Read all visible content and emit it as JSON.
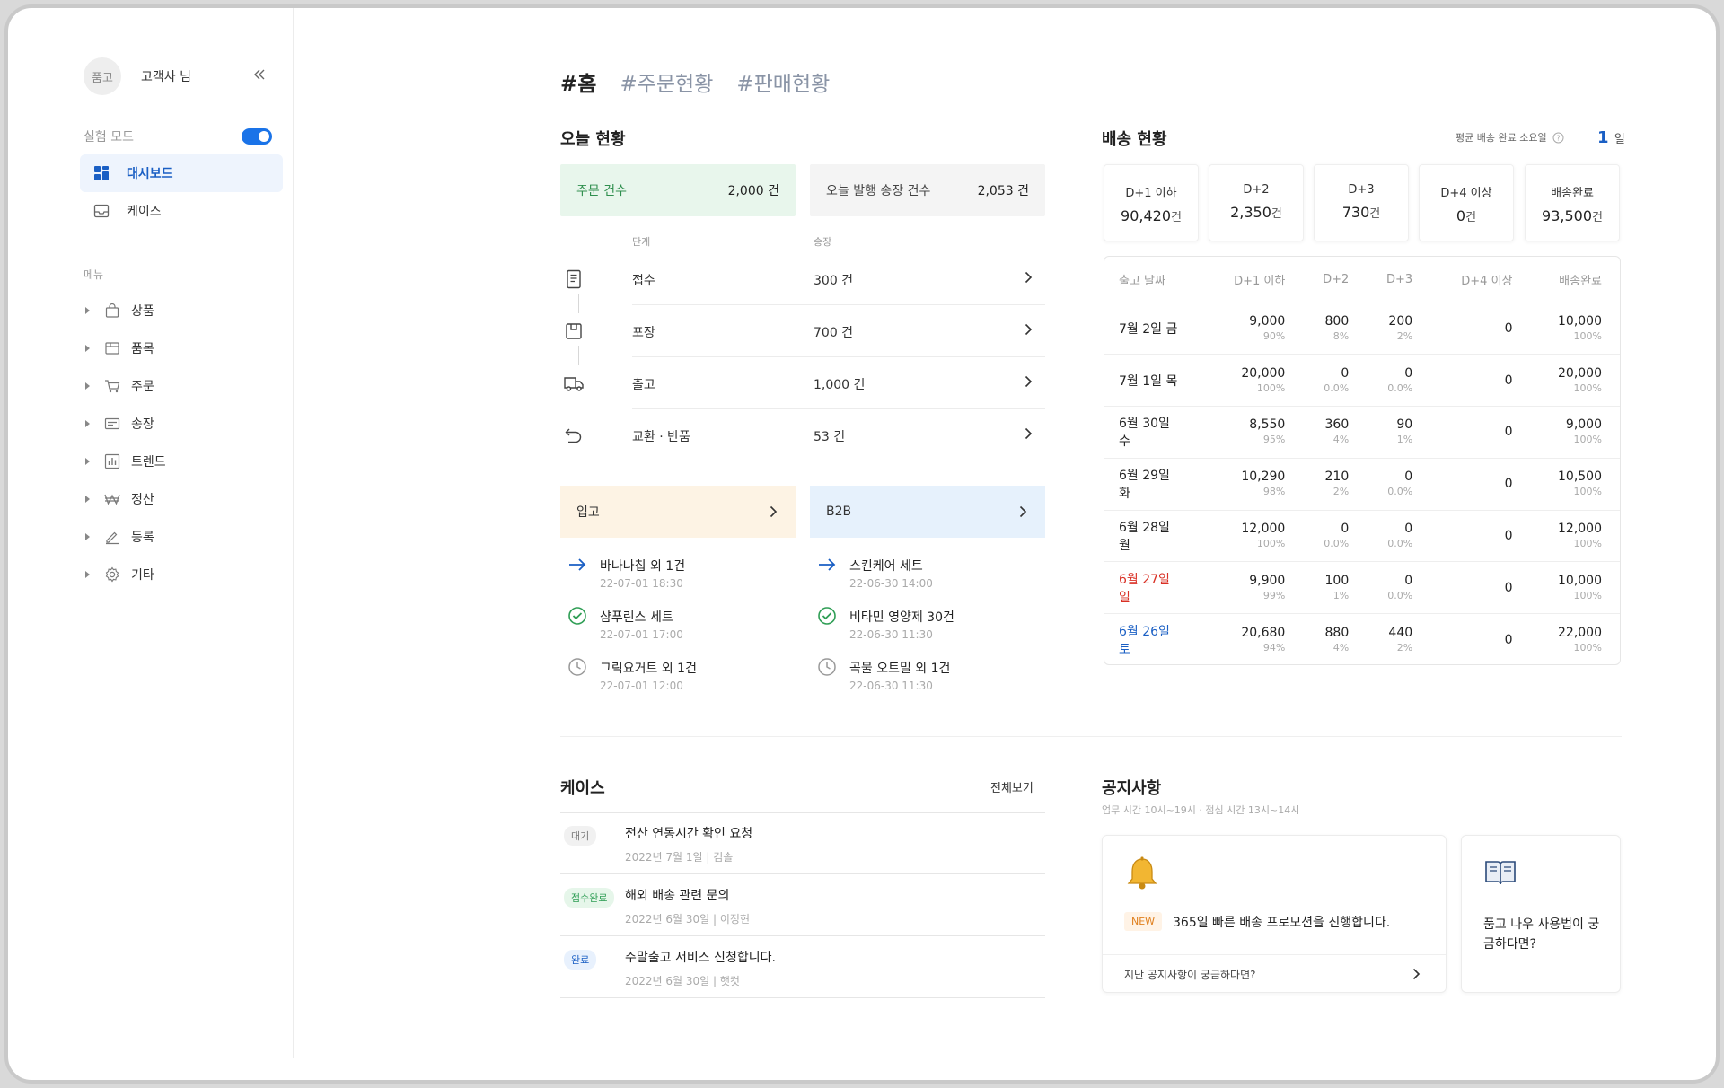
{
  "sidebar": {
    "avatar_text": "품고",
    "user_name": "고객사 님",
    "test_mode_label": "실험 모드",
    "nav": [
      {
        "label": "대시보드",
        "active": true,
        "icon": "dashboard-icon"
      },
      {
        "label": "케이스",
        "active": false,
        "icon": "inbox-icon"
      }
    ],
    "menu_label": "메뉴",
    "menu": [
      {
        "label": "상품",
        "icon": "bag-icon"
      },
      {
        "label": "품목",
        "icon": "box-icon"
      },
      {
        "label": "주문",
        "icon": "cart-icon"
      },
      {
        "label": "송장",
        "icon": "invoice-icon"
      },
      {
        "label": "트렌드",
        "icon": "chart-icon"
      },
      {
        "label": "정산",
        "icon": "won-icon"
      },
      {
        "label": "등록",
        "icon": "pencil-icon"
      },
      {
        "label": "기타",
        "icon": "gear-icon"
      }
    ]
  },
  "tabs": [
    "#홈",
    "#주문현황",
    "#판매현황"
  ],
  "today": {
    "title": "오늘 현황",
    "orders_label": "주문 건수",
    "orders_value": "2,000 건",
    "invoices_label": "오늘 발행 송장 건수",
    "invoices_value": "2,053 건",
    "col_stage": "단계",
    "col_invoice": "송장",
    "steps": [
      {
        "label": "접수",
        "count": "300 건",
        "icon": "receipt-icon"
      },
      {
        "label": "포장",
        "count": "700 건",
        "icon": "package-icon"
      },
      {
        "label": "출고",
        "count": "1,000 건",
        "icon": "truck-icon"
      },
      {
        "label": "교환 · 반품",
        "count": "53 건",
        "icon": "return-icon"
      }
    ],
    "inbound_label": "입고",
    "b2b_label": "B2B",
    "inbound_feed": [
      {
        "title": "바나나칩 외 1건",
        "time": "22-07-01 18:30",
        "icon": "arrow-right-icon"
      },
      {
        "title": "샴푸린스 세트",
        "time": "22-07-01 17:00",
        "icon": "check-circle-icon"
      },
      {
        "title": "그릭요거트 외 1건",
        "time": "22-07-01 12:00",
        "icon": "clock-icon"
      }
    ],
    "b2b_feed": [
      {
        "title": "스킨케어 세트",
        "time": "22-06-30 14:00",
        "icon": "arrow-right-icon"
      },
      {
        "title": "비타민 영양제 30건",
        "time": "22-06-30 11:30",
        "icon": "check-circle-icon"
      },
      {
        "title": "곡물 오트밀 외 1건",
        "time": "22-06-30 11:30",
        "icon": "clock-icon"
      }
    ]
  },
  "delivery": {
    "title": "배송 현황",
    "avg_label": "평균 배송 완료 소요일",
    "avg_value": "1",
    "avg_unit": "일",
    "cards": [
      {
        "label": "D+1 이하",
        "value": "90,420",
        "unit": "건"
      },
      {
        "label": "D+2",
        "value": "2,350",
        "unit": "건"
      },
      {
        "label": "D+3",
        "value": "730",
        "unit": "건"
      },
      {
        "label": "D+4 이상",
        "value": "0",
        "unit": "건"
      },
      {
        "label": "배송완료",
        "value": "93,500",
        "unit": "건"
      }
    ],
    "columns": [
      "출고 날짜",
      "D+1 이하",
      "D+2",
      "D+3",
      "D+4 이상",
      "배송완료"
    ],
    "rows": [
      {
        "date": "7월 2일 금",
        "day": "weekday",
        "d1": "9,000",
        "d1p": "90%",
        "d2": "800",
        "d2p": "8%",
        "d3": "200",
        "d3p": "2%",
        "d4": "0",
        "done": "10,000",
        "donep": "100%"
      },
      {
        "date": "7월 1일 목",
        "day": "weekday",
        "d1": "20,000",
        "d1p": "100%",
        "d2": "0",
        "d2p": "0.0%",
        "d3": "0",
        "d3p": "0.0%",
        "d4": "0",
        "done": "20,000",
        "donep": "100%"
      },
      {
        "date": "6월 30일 수",
        "day": "weekday",
        "d1": "8,550",
        "d1p": "95%",
        "d2": "360",
        "d2p": "4%",
        "d3": "90",
        "d3p": "1%",
        "d4": "0",
        "done": "9,000",
        "donep": "100%"
      },
      {
        "date": "6월 29일 화",
        "day": "weekday",
        "d1": "10,290",
        "d1p": "98%",
        "d2": "210",
        "d2p": "2%",
        "d3": "0",
        "d3p": "0.0%",
        "d4": "0",
        "done": "10,500",
        "donep": "100%"
      },
      {
        "date": "6월 28일 월",
        "day": "weekday",
        "d1": "12,000",
        "d1p": "100%",
        "d2": "0",
        "d2p": "0.0%",
        "d3": "0",
        "d3p": "0.0%",
        "d4": "0",
        "done": "12,000",
        "donep": "100%"
      },
      {
        "date": "6월 27일 일",
        "day": "sun",
        "d1": "9,900",
        "d1p": "99%",
        "d2": "100",
        "d2p": "1%",
        "d3": "0",
        "d3p": "0.0%",
        "d4": "0",
        "done": "10,000",
        "donep": "100%"
      },
      {
        "date": "6월 26일 토",
        "day": "sat",
        "d1": "20,680",
        "d1p": "94%",
        "d2": "880",
        "d2p": "4%",
        "d3": "440",
        "d3p": "2%",
        "d4": "0",
        "done": "22,000",
        "donep": "100%"
      }
    ]
  },
  "cases": {
    "title": "케이스",
    "see_all": "전체보기",
    "items": [
      {
        "badge": "대기",
        "badge_bg": "#f1f1f1",
        "badge_fg": "#777777",
        "title": "전산 연동시간 확인 요청",
        "sub": "2022년 7월 1일 | 김솔"
      },
      {
        "badge": "접수완료",
        "badge_bg": "#e6f6ea",
        "badge_fg": "#2f9e55",
        "title": "해외 배송 관련 문의",
        "sub": "2022년 6월 30일 | 이정현"
      },
      {
        "badge": "완료",
        "badge_bg": "#e8f1fd",
        "badge_fg": "#1a5fc4",
        "title": "주말출고 서비스 신청합니다.",
        "sub": "2022년 6월 30일 | 햇컷"
      }
    ]
  },
  "notices": {
    "title": "공지사항",
    "hours": "업무 시간 10시~19시 · 점심 시간 13시~14시",
    "new_badge": "NEW",
    "headline": "365일 빠른 배송 프로모션을 진행합니다.",
    "footer": "지난 공지사항이 궁금하다면?",
    "guide": "품고 나우 사용법이 궁금하다면?"
  },
  "colors": {
    "accent": "#1a73e8",
    "orders_bg": "#e8f6ec",
    "invoices_bg": "#f4f4f4",
    "inbound_bg": "#fdf3e4",
    "b2b_bg": "#e6f1fc"
  }
}
